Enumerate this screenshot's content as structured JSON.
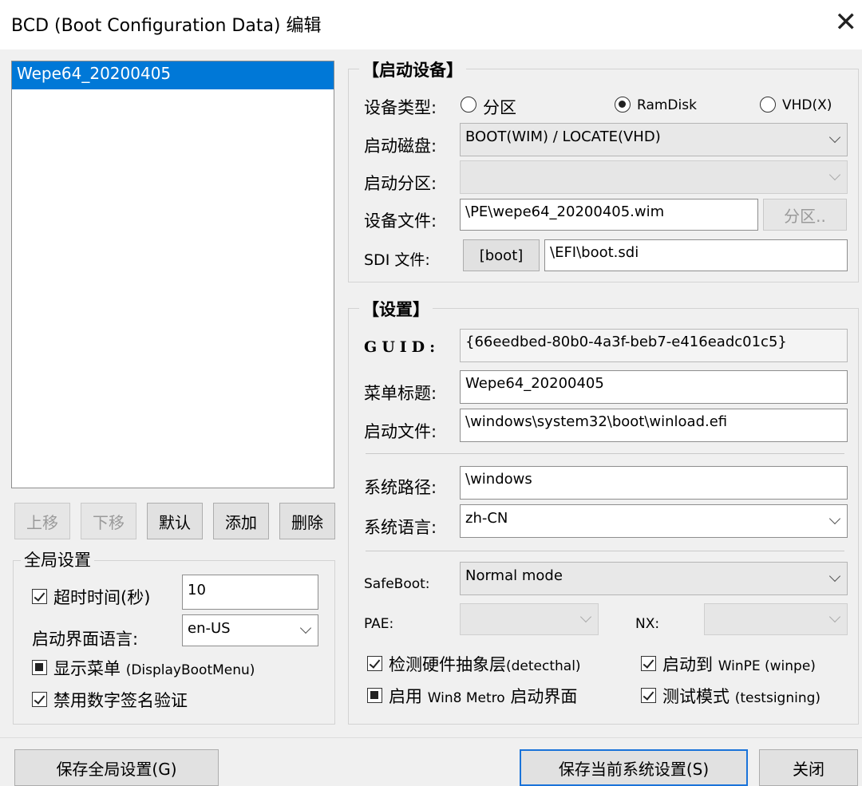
{
  "window": {
    "title": "BCD (Boot Configuration Data) 编辑"
  },
  "entries": [
    {
      "label": "Wepe64_20200405",
      "selected": true
    }
  ],
  "entry_buttons": {
    "up": "上移",
    "down": "下移",
    "default": "默认",
    "add": "添加",
    "delete": "删除"
  },
  "global": {
    "group_title": "全局设置",
    "timeout_label": "超时时间(秒)",
    "timeout_value": "10",
    "lang_label": "启动界面语言:",
    "lang_value": "en-US",
    "show_menu_label": "显示菜单",
    "show_menu_suffix": "(DisplayBootMenu)",
    "no_integrity_label": "禁用数字签名验证"
  },
  "device": {
    "group_title": "【启动设备】",
    "type_label": "设备类型:",
    "type_partition": "分区",
    "type_ramdisk": "RamDisk",
    "type_vhd": "VHD(X)",
    "disk_label": "启动磁盘:",
    "disk_value": "BOOT(WIM) / LOCATE(VHD)",
    "partition_label": "启动分区:",
    "partition_value": "",
    "file_label": "设备文件:",
    "file_value": "\\PE\\wepe64_20200405.wim",
    "file_button": "分区..",
    "sdi_label": "SDI 文件:",
    "sdi_button": "[boot]",
    "sdi_value": "\\EFI\\boot.sdi"
  },
  "settings": {
    "group_title": "【设置】",
    "guid_label": "GUID:",
    "guid_value": "{66eedbed-80b0-4a3f-beb7-e416eadc01c5}",
    "menu_title_label": "菜单标题:",
    "menu_title_value": "Wepe64_20200405",
    "boot_file_label": "启动文件:",
    "boot_file_value": "\\windows\\system32\\boot\\winload.efi",
    "sys_path_label": "系统路径:",
    "sys_path_value": "\\windows",
    "sys_lang_label": "系统语言:",
    "sys_lang_value": "zh-CN",
    "safeboot_label": "SafeBoot:",
    "safeboot_value": "Normal mode",
    "pae_label": "PAE:",
    "pae_value": "",
    "nx_label": "NX:",
    "nx_value": "",
    "detecthal_prefix": "检测硬件抽象层",
    "detecthal_suffix": "(detecthal)",
    "winpe_prefix": "启动到",
    "winpe_suffix": "WinPE (winpe)",
    "metro_prefix": "启用",
    "metro_mid": "Win8 Metro",
    "metro_suffix": "启动界面",
    "testsigning_prefix": "测试模式",
    "testsigning_suffix": "(testsigning)"
  },
  "footer": {
    "save_global": "保存全局设置(G)",
    "save_current": "保存当前系统设置(S)",
    "close": "关闭"
  }
}
